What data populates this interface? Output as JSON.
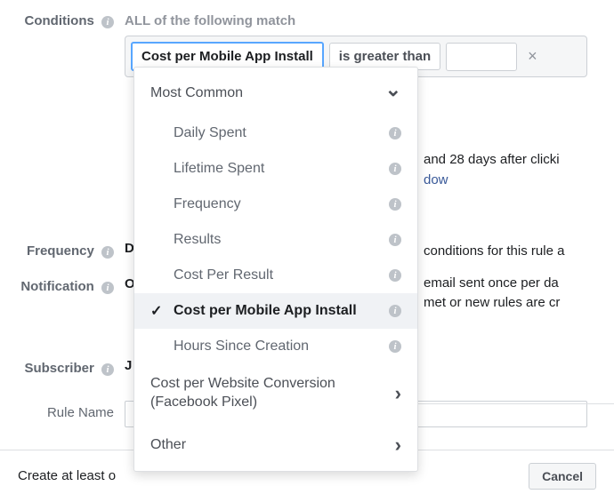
{
  "labels": {
    "conditions": "Conditions",
    "frequency": "Frequency",
    "notification": "Notification",
    "subscriber": "Subscriber",
    "rule_name": "Rule Name"
  },
  "conditions": {
    "header": "ALL of the following match",
    "metric": "Cost per Mobile App Install",
    "operator": "is greater than",
    "value": ""
  },
  "dropdown": {
    "group_most_common": "Most Common",
    "daily_spent": "Daily Spent",
    "lifetime_spent": "Lifetime Spent",
    "frequency": "Frequency",
    "results": "Results",
    "cost_per_result": "Cost Per Result",
    "cost_per_install": "Cost per Mobile App Install",
    "hours_since_creation": "Hours Since Creation",
    "cost_per_website_conv": "Cost per Website Conversion (Facebook Pixel)",
    "other": "Other"
  },
  "background": {
    "attribution_fragment": "and 28 days after clicki",
    "attribution_link": "dow",
    "notif_line1": "conditions for this rule a",
    "notif_line2a": "email sent once per da",
    "notif_line2b": "met or new rules are cr",
    "freq_prefix": "D",
    "notif_prefix": "O",
    "subscriber_prefix": "J",
    "create_text": "Create at least o",
    "cancel": "Cancel"
  }
}
